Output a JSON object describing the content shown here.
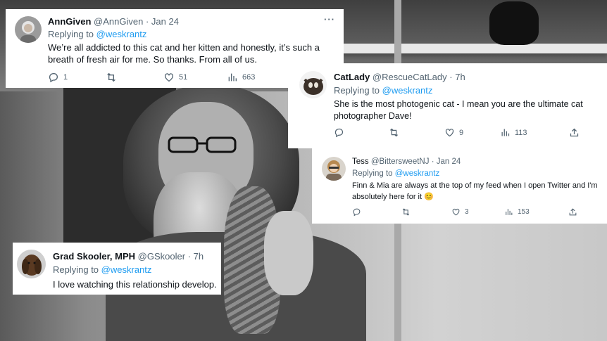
{
  "tweets": [
    {
      "name": "AnnGiven",
      "handle": "@AnnGiven",
      "time": "Jan 24",
      "replying_to_label": "Replying to",
      "replying_to": "@weskrantz",
      "text": "We’re all addicted to this cat and her kitten and honestly, it’s such a breath of fresh air for me. So thanks. From all of us.",
      "more_label": "···",
      "replies": "1",
      "retweets": "",
      "likes": "51",
      "views": "663"
    },
    {
      "name": "CatLady",
      "handle": "@RescueCatLady",
      "time": "7h",
      "replying_to_label": "Replying to",
      "replying_to": "@weskrantz",
      "text": "She is the most photogenic cat - I mean you are the ultimate cat photographer Dave!",
      "replies": "",
      "retweets": "",
      "likes": "9",
      "views": "113"
    },
    {
      "name": "Tess",
      "handle": "@BittersweetNJ",
      "time": "Jan 24",
      "replying_to_label": "Replying to",
      "replying_to": "@weskrantz",
      "text": "Finn & Mia are always at the top of my feed when I open Twitter and I'm absolutely here for it",
      "emoji": "😊",
      "replies": "",
      "retweets": "",
      "likes": "3",
      "views": "153"
    },
    {
      "name": "Grad Skooler, MPH",
      "handle": "@GSkooler",
      "time": "7h",
      "replying_to_label": "Replying to",
      "replying_to": "@weskrantz",
      "text": "I love watching this relationship develop."
    }
  ],
  "separator": "·",
  "colors": {
    "link": "#1d9bf0",
    "muted_text": "#536471",
    "text": "#0f1419",
    "card_bg": "#ffffff"
  },
  "icons": [
    "reply-icon",
    "retweet-icon",
    "like-icon",
    "views-icon",
    "share-icon",
    "more-icon"
  ]
}
